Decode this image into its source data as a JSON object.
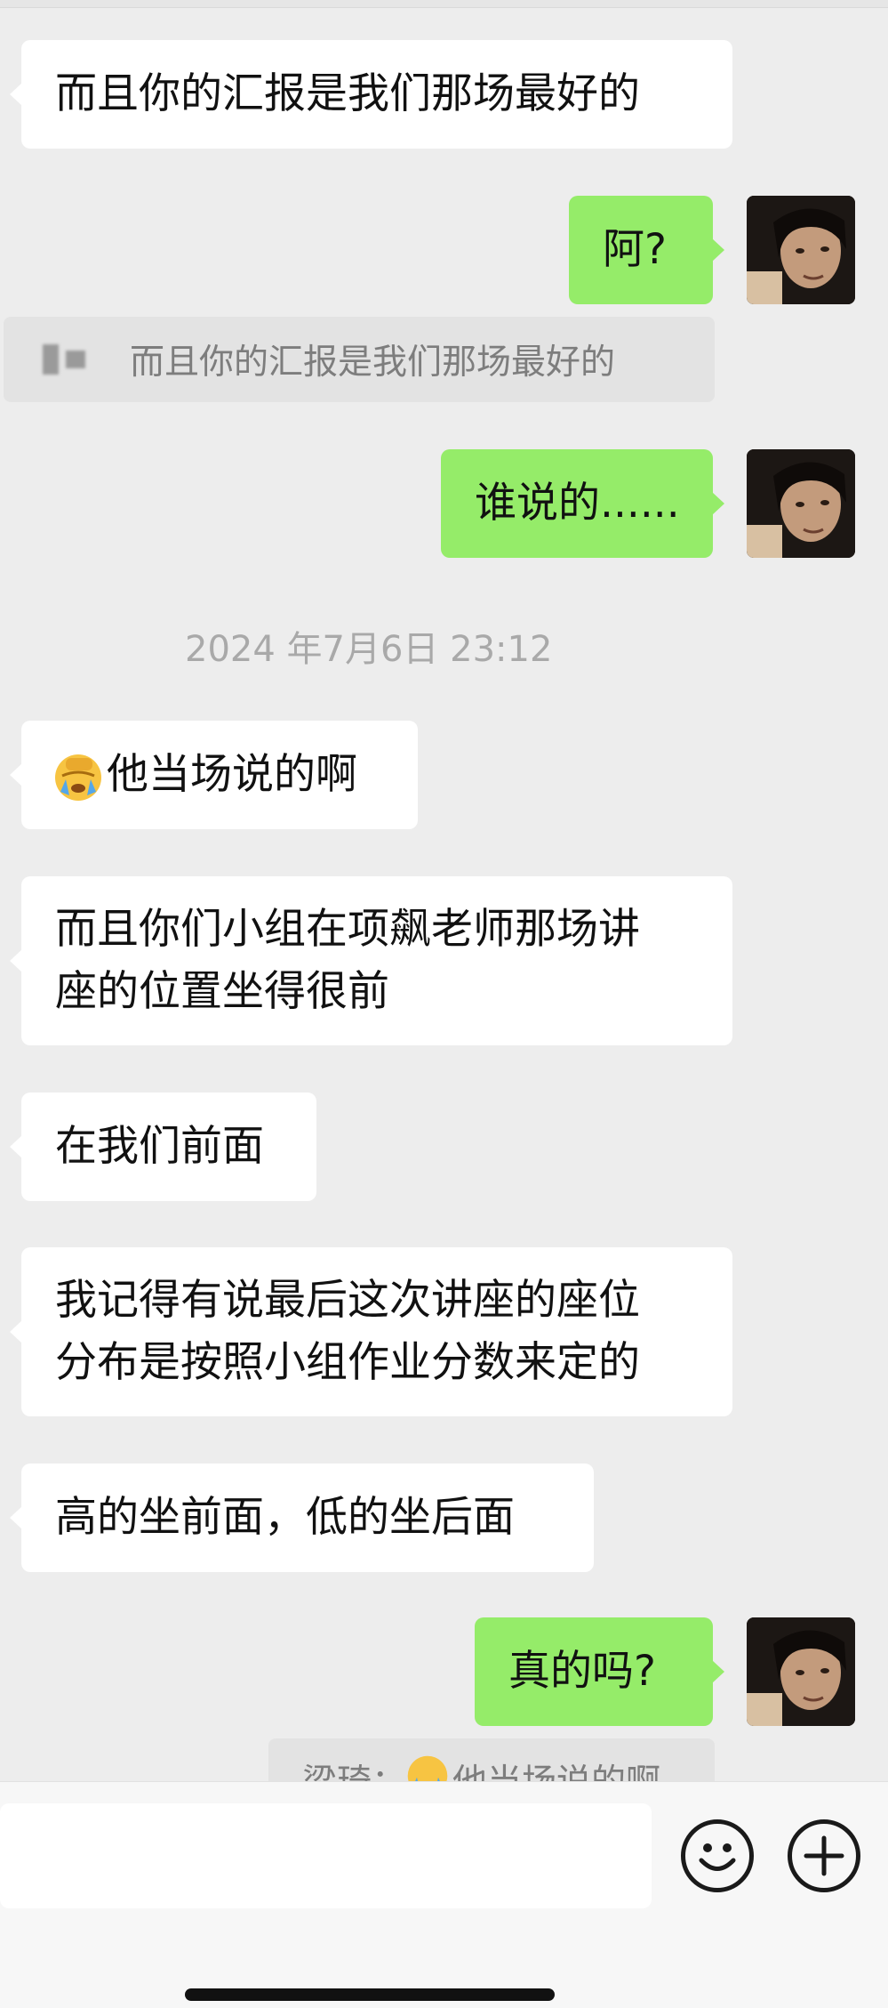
{
  "chat": {
    "messages": [
      {
        "dir": "in",
        "text": "而且你的汇报是我们那场最好的"
      },
      {
        "dir": "out",
        "text": "阿?"
      },
      {
        "dir": "quote",
        "name": "",
        "text": "而且你的汇报是我们那场最好的"
      },
      {
        "dir": "out",
        "text": "谁说的......"
      },
      {
        "dir": "time",
        "text": "2024 年7月6日 23:12"
      },
      {
        "dir": "in",
        "emoji": "facepalm",
        "text": "他当场说的啊"
      },
      {
        "dir": "in",
        "line1": "而且你们小组在项飙老师那场讲",
        "line2": "座的位置坐得很前"
      },
      {
        "dir": "in",
        "text": "在我们前面"
      },
      {
        "dir": "in",
        "line1": "我记得有说最后这次讲座的座位",
        "line2": "分布是按照小组作业分数来定的"
      },
      {
        "dir": "in",
        "text": "高的坐前面，低的坐后面"
      },
      {
        "dir": "out",
        "text": "真的吗?"
      },
      {
        "dir": "quote",
        "name": "梁琦：",
        "emoji": "facepalm",
        "text": "他当场说的啊"
      }
    ]
  },
  "input": {
    "value": "",
    "placeholder": ""
  },
  "icons": {
    "emoji_button": "smiley-icon",
    "more_button": "plus-icon",
    "avatar": "user-avatar-photo",
    "inline_emoji": "facepalm-emoji-icon"
  },
  "colors": {
    "background": "#ededed",
    "incoming_bubble": "#ffffff",
    "outgoing_bubble": "#95ec69",
    "quote_bubble": "#e3e3e3",
    "timestamp_text": "#a9a9a9"
  }
}
